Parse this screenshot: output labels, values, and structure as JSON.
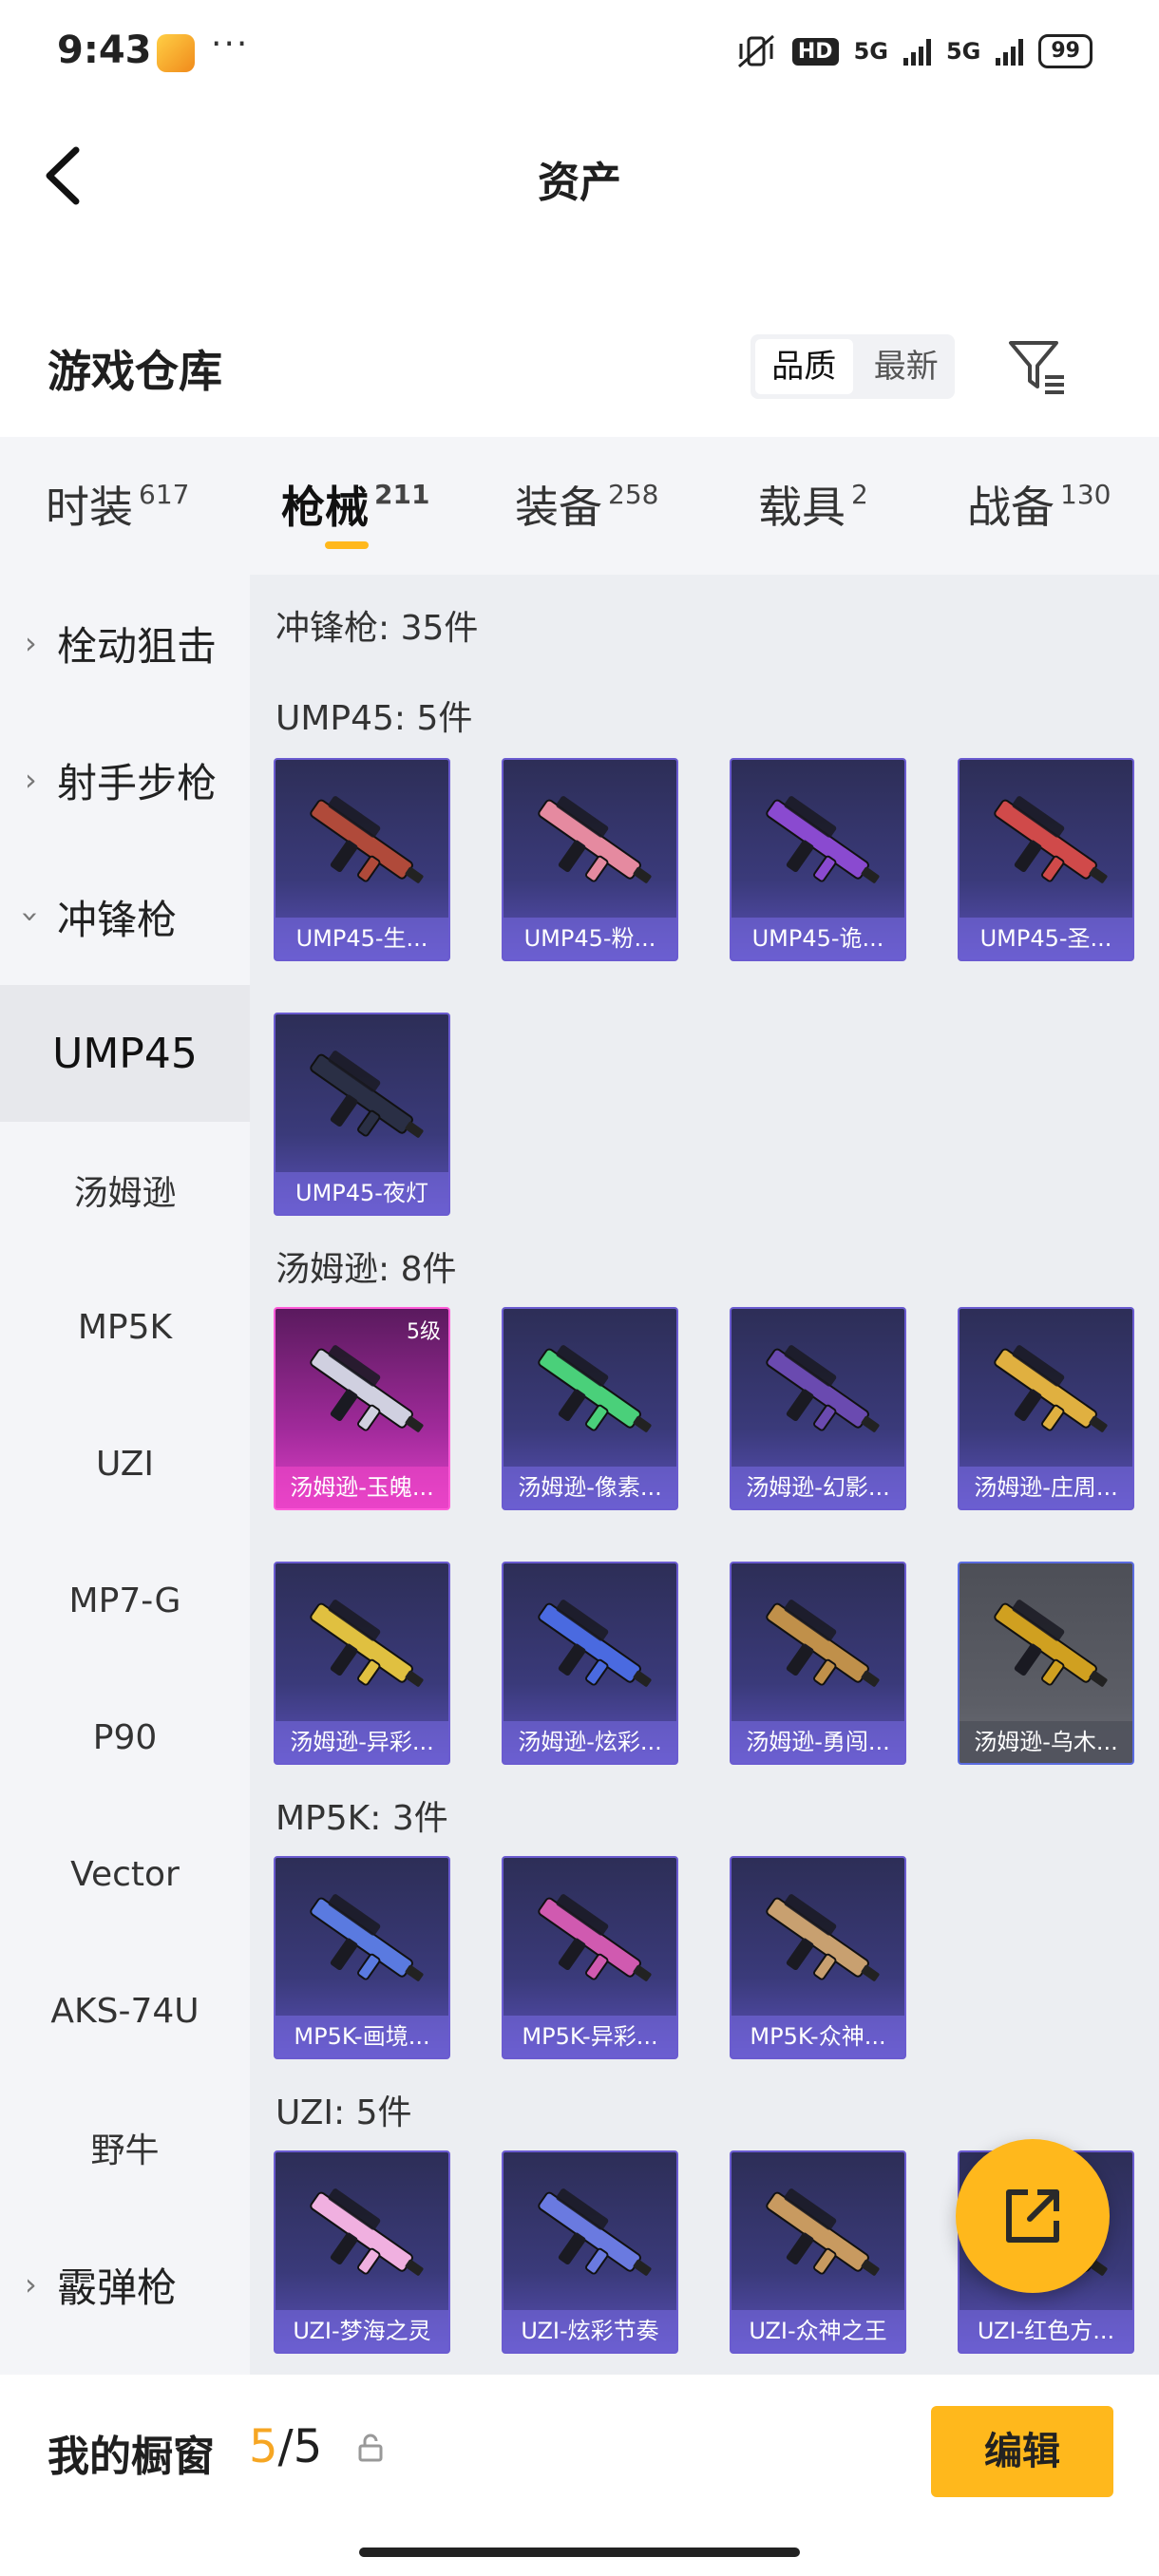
{
  "status_bar": {
    "time": "9:43",
    "more": "···",
    "hd": "HD",
    "net1": "5G",
    "net2": "5G",
    "battery": "99"
  },
  "header": {
    "title": "资产",
    "back_icon": "chevron-left-icon"
  },
  "warehouse": {
    "title": "游戏仓库",
    "sort_options": [
      "品质",
      "最新"
    ],
    "active_sort": "品质",
    "filter_icon": "filter-icon"
  },
  "tabs": [
    {
      "label": "时装",
      "count": "617"
    },
    {
      "label": "枪械",
      "count": "211"
    },
    {
      "label": "装备",
      "count": "258"
    },
    {
      "label": "载具",
      "count": "2"
    },
    {
      "label": "战备",
      "count": "130"
    }
  ],
  "active_tab": "枪械",
  "sidebar": {
    "items": [
      {
        "label": "栓动狙击",
        "type": "category"
      },
      {
        "label": "射手步枪",
        "type": "category"
      },
      {
        "label": "冲锋枪",
        "type": "category"
      },
      {
        "label": "UMP45",
        "type": "sub"
      },
      {
        "label": "汤姆逊",
        "type": "sub"
      },
      {
        "label": "MP5K",
        "type": "sub"
      },
      {
        "label": "UZI",
        "type": "sub"
      },
      {
        "label": "MP7-G",
        "type": "sub"
      },
      {
        "label": "P90",
        "type": "sub"
      },
      {
        "label": "Vector",
        "type": "sub"
      },
      {
        "label": "AKS-74U",
        "type": "sub"
      },
      {
        "label": "野牛",
        "type": "sub"
      },
      {
        "label": "霰弹枪",
        "type": "category"
      }
    ],
    "selected": "UMP45"
  },
  "content": {
    "category_header": "冲锋枪: 35件",
    "groups": [
      {
        "title": "UMP45: 5件",
        "items": [
          {
            "name": "UMP45-生...",
            "color": "#b04a3a"
          },
          {
            "name": "UMP45-粉...",
            "color": "#e58aa0"
          },
          {
            "name": "UMP45-诡...",
            "color": "#8a4ad0"
          },
          {
            "name": "UMP45-圣...",
            "color": "#d04a4a"
          },
          {
            "name": "UMP45-夜灯",
            "color": "#2a2f45"
          }
        ]
      },
      {
        "title": "汤姆逊: 8件",
        "items": [
          {
            "name": "汤姆逊-玉魄...",
            "color": "#d0d0e0",
            "level": "5级",
            "style": "pink"
          },
          {
            "name": "汤姆逊-像素...",
            "color": "#4ad07a"
          },
          {
            "name": "汤姆逊-幻影...",
            "color": "#6a4ab0"
          },
          {
            "name": "汤姆逊-庄周...",
            "color": "#e0b040"
          },
          {
            "name": "汤姆逊-异彩...",
            "color": "#e0c040"
          },
          {
            "name": "汤姆逊-炫彩...",
            "color": "#4a6ae0"
          },
          {
            "name": "汤姆逊-勇闯...",
            "color": "#c0904a"
          },
          {
            "name": "汤姆逊-乌木...",
            "color": "#d0a020",
            "style": "gray"
          }
        ]
      },
      {
        "title": "MP5K: 3件",
        "items": [
          {
            "name": "MP5K-画境...",
            "color": "#5a7ae0"
          },
          {
            "name": "MP5K-异彩...",
            "color": "#d05ab0"
          },
          {
            "name": "MP5K-众神...",
            "color": "#c8a070"
          }
        ]
      },
      {
        "title": "UZI: 5件",
        "items": [
          {
            "name": "UZI-梦海之灵",
            "color": "#f0b0e0"
          },
          {
            "name": "UZI-炫彩节奏",
            "color": "#6a7ae0"
          },
          {
            "name": "UZI-众神之王",
            "color": "#c89a60"
          },
          {
            "name": "UZI-红色方...",
            "color": "#c04040"
          }
        ]
      }
    ]
  },
  "fab_icon": "share-icon",
  "bottom_bar": {
    "label": "我的橱窗",
    "current": "5",
    "separator": "/",
    "total": "5",
    "lock_icon": "lock-icon",
    "edit_label": "编辑"
  }
}
